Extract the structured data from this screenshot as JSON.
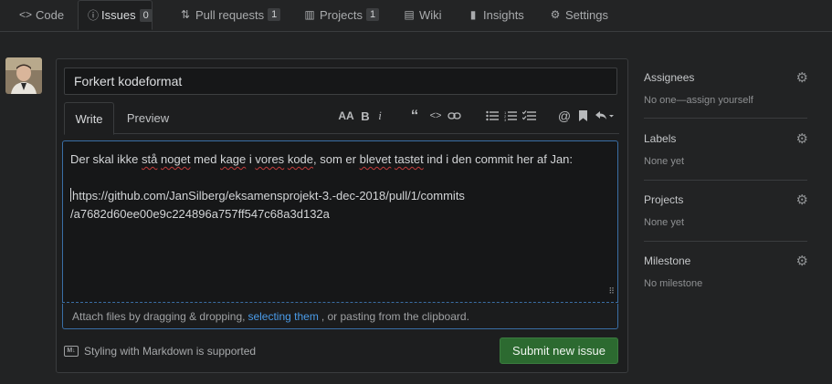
{
  "tabs": {
    "code": {
      "label": "Code",
      "icon": "code-icon"
    },
    "issues": {
      "label": "Issues",
      "count": "0",
      "icon": "issue-opened-icon"
    },
    "pull_requests": {
      "label": "Pull requests",
      "count": "1",
      "icon": "git-pull-request-icon"
    },
    "projects": {
      "label": "Projects",
      "count": "1",
      "icon": "project-icon"
    },
    "wiki": {
      "label": "Wiki",
      "icon": "book-icon"
    },
    "insights": {
      "label": "Insights",
      "icon": "graph-icon"
    },
    "settings": {
      "label": "Settings",
      "icon": "gear-icon"
    }
  },
  "issue_form": {
    "title_value": "Forkert kodeformat",
    "write_tab": "Write",
    "preview_tab": "Preview",
    "toolbar": [
      "text-size-icon",
      "bold-icon",
      "italic-icon",
      "quote-icon",
      "code-icon",
      "link-icon",
      "unordered-list-icon",
      "ordered-list-icon",
      "task-list-icon",
      "mention-icon",
      "bookmark-icon",
      "reply-icon"
    ],
    "body": {
      "line1_part1": "Der skal ikke ",
      "line1_w1": "stå",
      "line1_part2": " ",
      "line1_w2": "noget",
      "line1_part3": " med ",
      "line1_w3": "kage",
      "line1_part4": " i ",
      "line1_w4": "vores",
      "line1_part5": " ",
      "line1_w5": "kode",
      "line1_part6": ", som er ",
      "line1_w6": "blevet",
      "line1_part7": " ",
      "line1_w7": "tastet",
      "line1_part8": " ind i den commit her af Jan:",
      "line2": "https://github.com/JanSilberg/eksamensprojekt-3.-dec-2018/pull/1/commits",
      "line3": "/a7682d60ee00e9c224896a757ff547c68a3d132a"
    },
    "attach_prefix": "Attach files by dragging & dropping,",
    "attach_link": "selecting them",
    "attach_suffix": ", or pasting from the clipboard.",
    "markdown_note": "Styling with Markdown is supported",
    "submit_label": "Submit new issue"
  },
  "sidebar": {
    "assignees": {
      "heading": "Assignees",
      "value": "No one—assign yourself"
    },
    "labels": {
      "heading": "Labels",
      "value": "None yet"
    },
    "projects": {
      "heading": "Projects",
      "value": "None yet"
    },
    "milestone": {
      "heading": "Milestone",
      "value": "No milestone"
    }
  },
  "colors": {
    "accent_blue": "#4a9be8",
    "submit_green": "#2c6a30",
    "background": "#222324"
  }
}
